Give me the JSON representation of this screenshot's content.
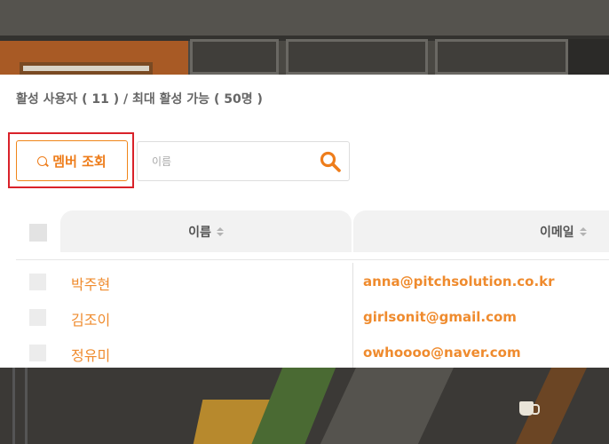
{
  "summary": {
    "active_users_text": "활성 사용자 ( 11 ) / 최대 활성 가능 ( 50명 )"
  },
  "toolbar": {
    "member_lookup_label": "멤버 조회",
    "search_placeholder": "이름",
    "search_value": ""
  },
  "table": {
    "columns": [
      "이름",
      "이메일"
    ],
    "rows": [
      {
        "name": "박주현",
        "email": "anna@pitchsolution.co.kr"
      },
      {
        "name": "김조이",
        "email": "girlsonit@gmail.com"
      },
      {
        "name": "정유미",
        "email": "owhoooo@naver.com"
      }
    ]
  },
  "colors": {
    "accent": "#ee7d1b",
    "highlight_border": "#d9222a",
    "header_bg": "#f2f2f2"
  },
  "icons": {
    "member_button": "search-icon",
    "search_box": "search-icon",
    "sort": "sort-icon"
  }
}
